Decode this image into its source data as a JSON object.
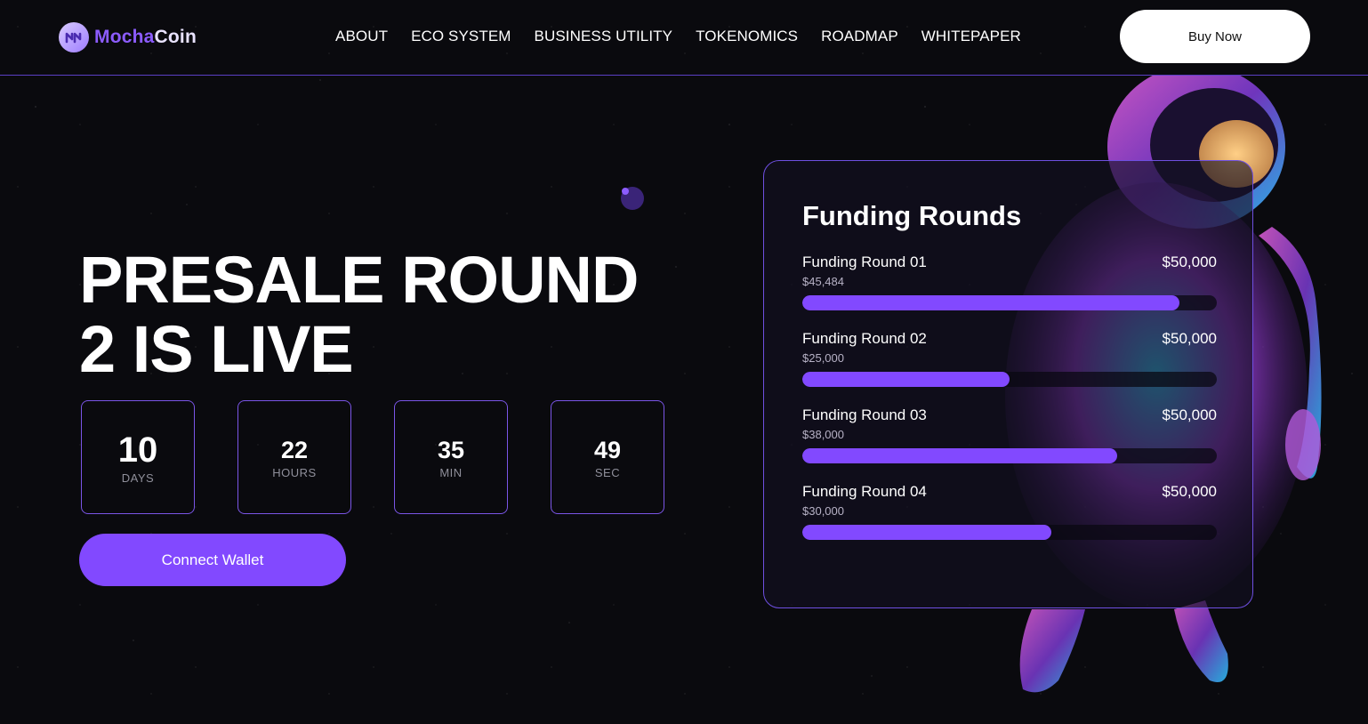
{
  "header": {
    "logo": {
      "part1": "Mocha",
      "part2": "Coin"
    },
    "nav": [
      "ABOUT",
      "ECO SYSTEM",
      "BUSINESS UTILITY",
      "TOKENOMICS",
      "ROADMAP",
      "WHITEPAPER"
    ],
    "buy_label": "Buy Now"
  },
  "hero": {
    "line1": "PRESALE ROUND",
    "line2": "2 IS LIVE",
    "countdown": [
      {
        "value": "10",
        "label": "DAYS"
      },
      {
        "value": "22",
        "label": "HOURS"
      },
      {
        "value": "35",
        "label": "MIN"
      },
      {
        "value": "49",
        "label": "SEC"
      }
    ],
    "connect_label": "Connect Wallet"
  },
  "funding": {
    "title": "Funding Rounds",
    "rounds": [
      {
        "name": "Funding Round 01",
        "raised": "$45,484",
        "goal": "$50,000",
        "progress": 0.91
      },
      {
        "name": "Funding Round 02",
        "raised": "$25,000",
        "goal": "$50,000",
        "progress": 0.5
      },
      {
        "name": "Funding Round 03",
        "raised": "$38,000",
        "goal": "$50,000",
        "progress": 0.76
      },
      {
        "name": "Funding Round 04",
        "raised": "$30,000",
        "goal": "$50,000",
        "progress": 0.6
      }
    ]
  },
  "colors": {
    "accent": "#8249ff",
    "background": "#0a0a0e"
  }
}
